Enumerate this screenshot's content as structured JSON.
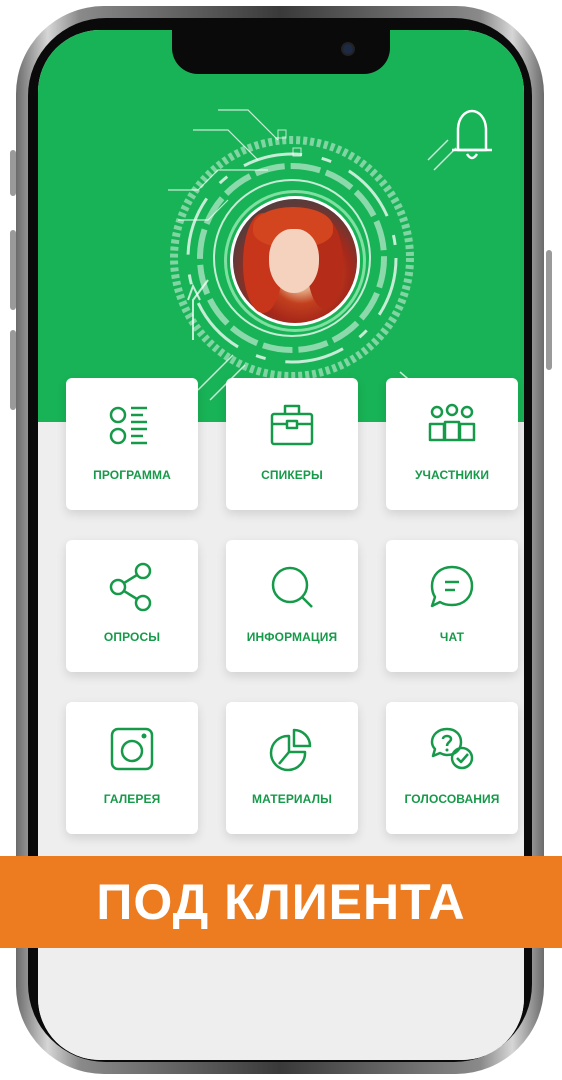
{
  "colors": {
    "brand_green": "#18b356",
    "label_green": "#169a4a",
    "banner_orange": "#ec7c1f"
  },
  "header": {
    "notification_icon": "bell-icon"
  },
  "profile": {
    "avatar_icon": "user-avatar"
  },
  "menu": [
    {
      "label": "ПРОГРАММА",
      "icon": "list-icon"
    },
    {
      "label": "СПИКЕРЫ",
      "icon": "briefcase-icon"
    },
    {
      "label": "УЧАСТНИКИ",
      "icon": "people-icon"
    },
    {
      "label": "ОПРОСЫ",
      "icon": "share-icon"
    },
    {
      "label": "ИНФОРМАЦИЯ",
      "icon": "search-icon"
    },
    {
      "label": "ЧАТ",
      "icon": "chat-icon"
    },
    {
      "label": "ГАЛЕРЕЯ",
      "icon": "instagram-icon"
    },
    {
      "label": "МАТЕРИАЛЫ",
      "icon": "pie-chart-icon"
    },
    {
      "label": "ГОЛОСОВАНИЯ",
      "icon": "vote-icon"
    }
  ],
  "banner": {
    "text": "ПОД КЛИЕНТА"
  }
}
